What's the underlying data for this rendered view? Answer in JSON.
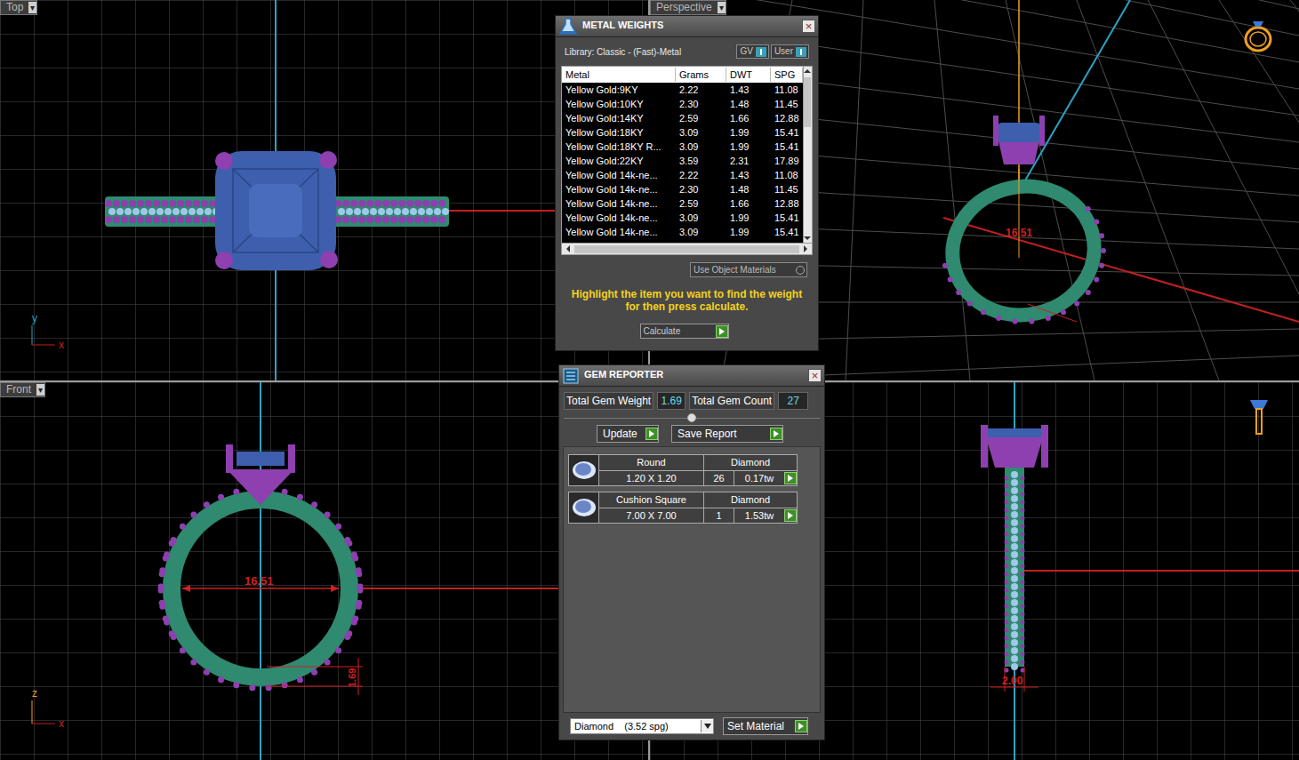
{
  "viewports": {
    "label_menu_glyph": "▾",
    "top": {
      "label": "Top",
      "axis_labels": [
        "y",
        "x"
      ]
    },
    "perspective": {
      "label": "Perspective",
      "dimension": "16.51"
    },
    "front": {
      "label": "Front",
      "axis_labels": [
        "z",
        "x"
      ],
      "diameter": "16.51",
      "thickness": "1.69"
    },
    "right": {
      "width": "2.00"
    }
  },
  "metal_weights": {
    "title": "METAL WEIGHTS",
    "close": "×",
    "library": "Library: Classic - (Fast)-Metal",
    "toggles": [
      {
        "label": "GV",
        "on": true
      },
      {
        "label": "User",
        "on": true
      }
    ],
    "columns": [
      "Metal",
      "Grams",
      "DWT",
      "SPG"
    ],
    "rows": [
      [
        "Yellow Gold:9KY",
        "2.22",
        "1.43",
        "11.08"
      ],
      [
        "Yellow Gold:10KY",
        "2.30",
        "1.48",
        "11.45"
      ],
      [
        "Yellow Gold:14KY",
        "2.59",
        "1.66",
        "12.88"
      ],
      [
        "Yellow Gold:18KY",
        "3.09",
        "1.99",
        "15.41"
      ],
      [
        "Yellow Gold:18KY R...",
        "3.09",
        "1.99",
        "15.41"
      ],
      [
        "Yellow Gold:22KY",
        "3.59",
        "2.31",
        "17.89"
      ],
      [
        "Yellow Gold 14k-ne...",
        "2.22",
        "1.43",
        "11.08"
      ],
      [
        "Yellow Gold 14k-ne...",
        "2.30",
        "1.48",
        "11.45"
      ],
      [
        "Yellow Gold 14k-ne...",
        "2.59",
        "1.66",
        "12.88"
      ],
      [
        "Yellow Gold 14k-ne...",
        "3.09",
        "1.99",
        "15.41"
      ],
      [
        "Yellow Gold 14k-ne...",
        "3.09",
        "1.99",
        "15.41"
      ]
    ],
    "use_object_materials": "Use Object Materials",
    "message": "Highlight the item you want to find the weight for then press calculate.",
    "calculate": "Calculate"
  },
  "gem_reporter": {
    "title": "GEM REPORTER",
    "close": "×",
    "total_weight_label": "Total Gem Weight",
    "total_weight": "1.69",
    "total_count_label": "Total Gem Count",
    "total_count": "27",
    "buttons": [
      "Update",
      "Save Report"
    ],
    "gems": [
      {
        "shape": "Round",
        "material": "Diamond",
        "size": "1.20 X 1.20",
        "count": "26",
        "weight": "0.17tw"
      },
      {
        "shape": "Cushion Square",
        "material": "Diamond",
        "size": "7.00 X 7.00",
        "count": "1",
        "weight": "1.53tw"
      }
    ],
    "material_select": "Diamond    (3.52 spg)",
    "set_material": "Set Material"
  }
}
